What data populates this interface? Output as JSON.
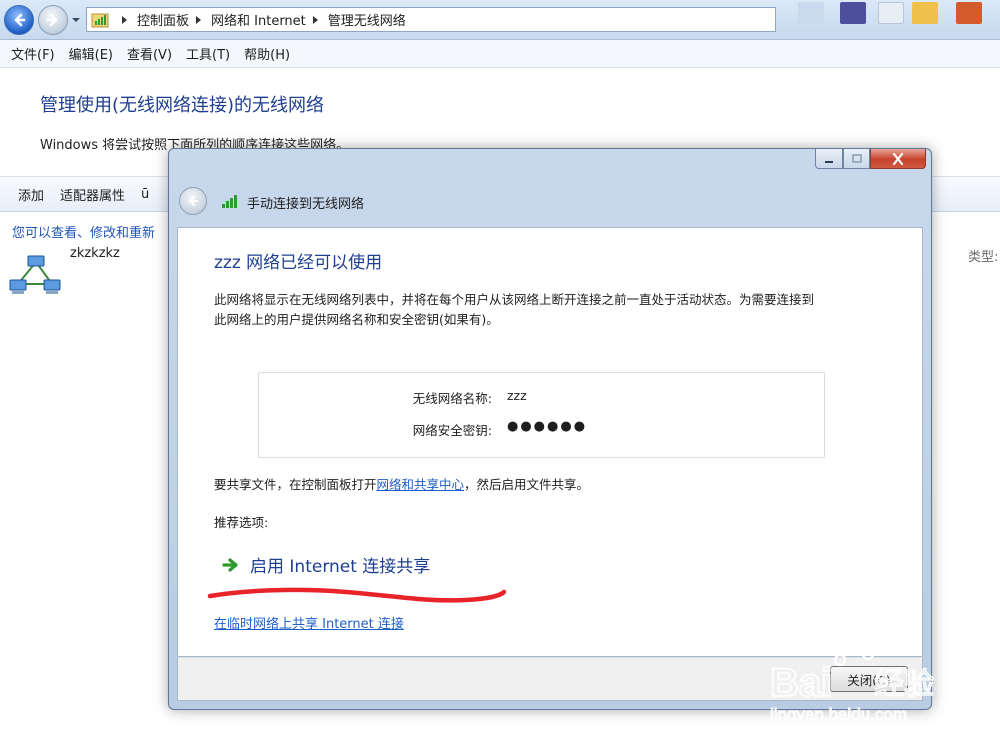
{
  "address_bar": {
    "crumbs": [
      "控制面板",
      "网络和 Internet",
      "管理无线网络"
    ]
  },
  "menu": {
    "items": [
      "文件(F)",
      "编辑(E)",
      "查看(V)",
      "工具(T)",
      "帮助(H)"
    ]
  },
  "main": {
    "title": "管理使用(无线网络连接)的无线网络",
    "description": "Windows 将尝试按照下面所列的顺序连接这些网络。",
    "toolbar": [
      "添加",
      "适配器属性",
      "ū"
    ],
    "hint": "您可以查看、修改和重新",
    "network_name": "zkzkzkz",
    "type_column": "类型:"
  },
  "dialog": {
    "title": "手动连接到无线网络",
    "heading": "zzz 网络已经可以使用",
    "paragraph": "此网络将显示在无线网络列表中，并将在每个用户从该网络上断开连接之前一直处于活动状态。为需要连接到此网络上的用户提供网络名称和安全密钥(如果有)。",
    "info": {
      "name_label": "无线网络名称:",
      "name_value": "zzz",
      "key_label": "网络安全密钥:",
      "key_value": "●●●●●●"
    },
    "share": {
      "prefix": "要共享文件，在控制面板打开",
      "link": "网络和共享中心",
      "suffix": "，然后启用文件共享。"
    },
    "recommended_label": "推荐选项:",
    "recommended_option": "启用 Internet 连接共享",
    "adhoc_link": "在临时网络上共享 Internet 连接",
    "close_button": "关闭(C)"
  },
  "watermark": {
    "brand": "Bai",
    "brand_cn": "经验",
    "url": "jingyan.baidu.com"
  },
  "colors": {
    "accent_blue": "#1e3f91",
    "link_blue": "#1e5ec8",
    "annotation_red": "#e8232a"
  }
}
